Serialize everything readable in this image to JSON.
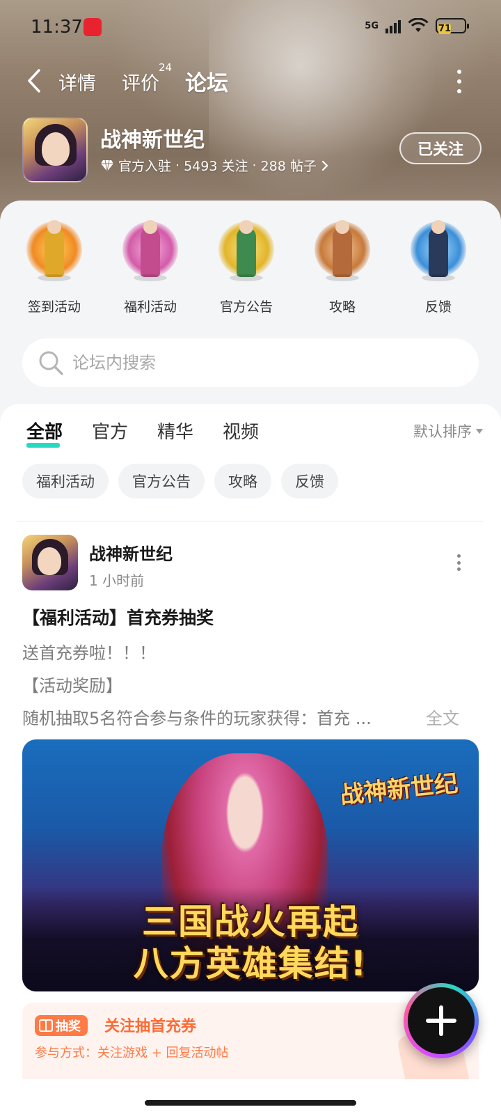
{
  "status_bar": {
    "time": "11:37",
    "network": "5G",
    "battery": "71"
  },
  "nav": {
    "tabs": [
      {
        "label": "详情"
      },
      {
        "label": "评价",
        "badge": "24"
      },
      {
        "label": "论坛"
      }
    ],
    "active_tab": "论坛",
    "accent_color": "#26d9c3"
  },
  "game": {
    "title": "战神新世纪",
    "official": "官方入驻",
    "followers": "5493 关注",
    "posts": "288 帖子",
    "sep": "·",
    "follow_label": "已关注"
  },
  "shortcuts": [
    {
      "label": "签到活动",
      "color": "#f08a24"
    },
    {
      "label": "福利活动",
      "color": "#d35aa8"
    },
    {
      "label": "官方公告",
      "color": "#e2b52a"
    },
    {
      "label": "攻略",
      "color": "#c77a3a"
    },
    {
      "label": "反馈",
      "color": "#3a8fd8"
    }
  ],
  "search": {
    "placeholder": "论坛内搜索"
  },
  "feed": {
    "tabs": [
      {
        "label": "全部"
      },
      {
        "label": "官方"
      },
      {
        "label": "精华"
      },
      {
        "label": "视频"
      }
    ],
    "active_tab": "全部",
    "sort_label": "默认排序",
    "chips": [
      {
        "label": "福利活动"
      },
      {
        "label": "官方公告"
      },
      {
        "label": "攻略"
      },
      {
        "label": "反馈"
      }
    ]
  },
  "post": {
    "author": "战神新世纪",
    "time": "1 小时前",
    "title": "【福利活动】首充券抽奖",
    "lines": [
      "送首充券啦！！！",
      "【活动奖励】",
      "随机抽取5名符合参与条件的玩家获得：首充 ..."
    ],
    "full_text_label": "全文",
    "image": {
      "logo": "战神新世纪",
      "slogan_1": "三国战火再起",
      "slogan_2": "八方英雄集结!"
    },
    "lottery": {
      "badge": "抽奖",
      "title": "关注抽首充券",
      "method": "参与方式：关注游戏 + 回复活动帖"
    }
  }
}
